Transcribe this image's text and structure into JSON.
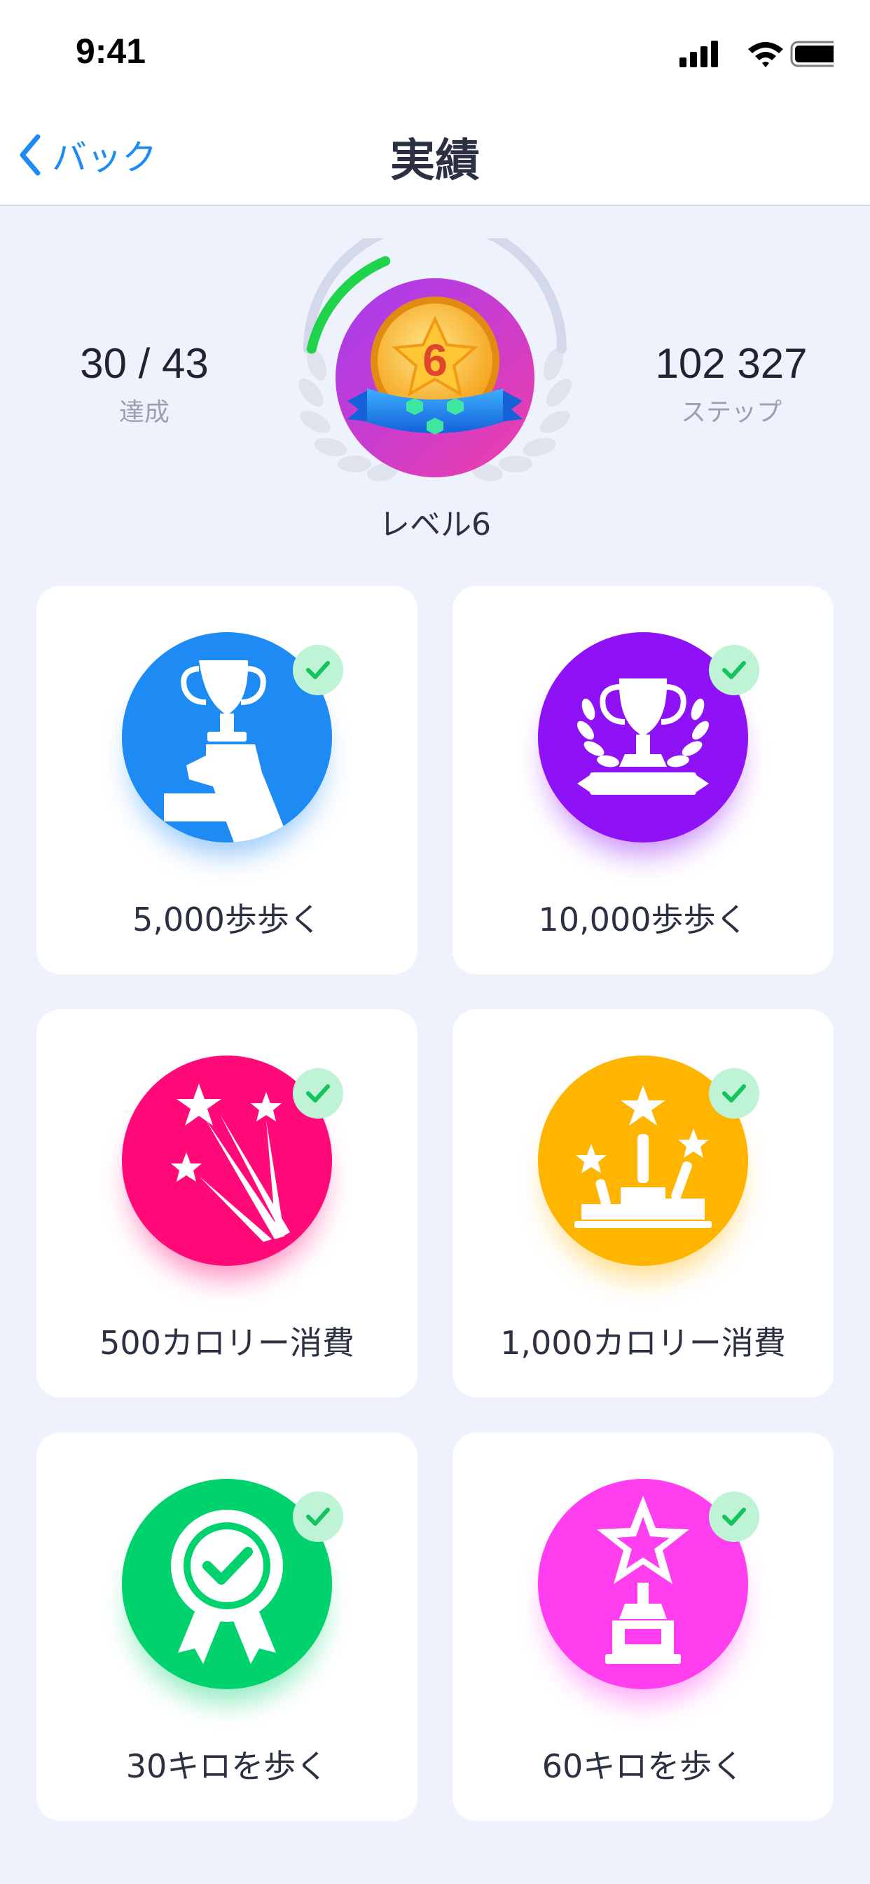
{
  "status": {
    "time": "9:41"
  },
  "nav": {
    "back_label": "バック",
    "title": "実績"
  },
  "summary": {
    "achieved_value": "30 / 43",
    "achieved_label": "達成",
    "steps_value": "102 327",
    "steps_label": "ステップ",
    "level_label": "レベル6",
    "level_number": "6",
    "level_progress": 0.35
  },
  "achievements": [
    {
      "label": "5,000歩歩く",
      "icon": "hand-trophy-icon",
      "color": "#1E8BF5",
      "completed": true
    },
    {
      "label": "10,000歩歩く",
      "icon": "trophy-laurel-icon",
      "color": "#8E12F5",
      "completed": true
    },
    {
      "label": "500カロリー消費",
      "icon": "shooting-stars-icon",
      "color": "#FF0A78",
      "completed": true
    },
    {
      "label": "1,000カロリー消費",
      "icon": "podium-stars-icon",
      "color": "#FFB400",
      "completed": true
    },
    {
      "label": "30キロを歩く",
      "icon": "ribbon-medal-icon",
      "color": "#00D26E",
      "completed": true
    },
    {
      "label": "60キロを歩く",
      "icon": "star-trophy-icon",
      "color": "#FF3EF0",
      "completed": true
    }
  ],
  "colors": {
    "accent": "#1E8BF5",
    "background": "#EEF2FC",
    "progress": "#1FD34A",
    "check_bg": "#BFF3D6",
    "check": "#13C35C"
  }
}
